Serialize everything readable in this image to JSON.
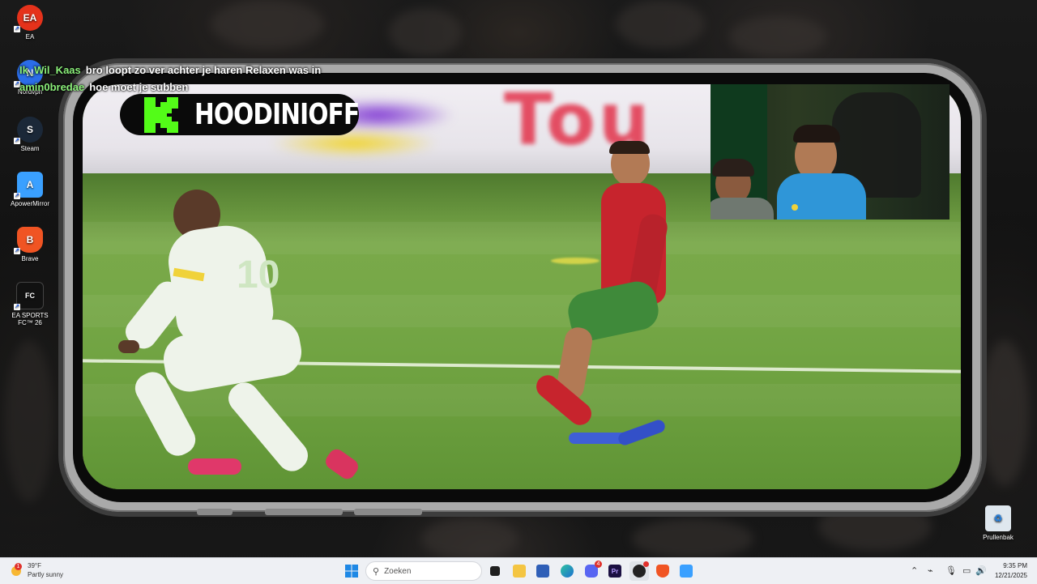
{
  "desktop": {
    "icons": [
      {
        "label": "EA",
        "glyph": "EA",
        "color": "#e5321b"
      },
      {
        "label": "Nordvpn",
        "glyph": "N",
        "color": "#2b6de8"
      },
      {
        "label": "Steam",
        "glyph": "S",
        "color": "#1b2838"
      },
      {
        "label": "ApowerMirror",
        "glyph": "A",
        "color": "#3aa0ff"
      },
      {
        "label": "Brave",
        "glyph": "B",
        "color": "#f05423"
      },
      {
        "label": "EA SPORTS FC™ 26",
        "glyph": "FC",
        "color": "#111111"
      }
    ],
    "recycle_bin": {
      "label": "Prullenbak"
    }
  },
  "chat": {
    "messages": [
      {
        "user": "Ik_Wil_Kaas",
        "text": "bro loopt zo ver achter je haren Relaxen was in"
      },
      {
        "user": "amin0bredae",
        "text": "hoe moet je subben"
      }
    ]
  },
  "stream": {
    "channel_name": "HOODINIOFF",
    "platform_logo": "kick-logo",
    "brand_color": "#53fc18",
    "player_number": "10"
  },
  "taskbar": {
    "weather": {
      "temp": "39°F",
      "condition": "Partly sunny",
      "badge": "1"
    },
    "search_placeholder": "Zoeken",
    "apps": [
      "start-icon",
      "search-icon",
      "task-view-icon",
      "file-explorer-icon",
      "store-icon",
      "edge-icon",
      "discord-icon",
      "premiere-icon",
      "obs-icon",
      "brave-icon",
      "apowermirror-icon"
    ],
    "discord_badge": "4",
    "time": "9:35 PM",
    "date": "12/21/2025"
  }
}
